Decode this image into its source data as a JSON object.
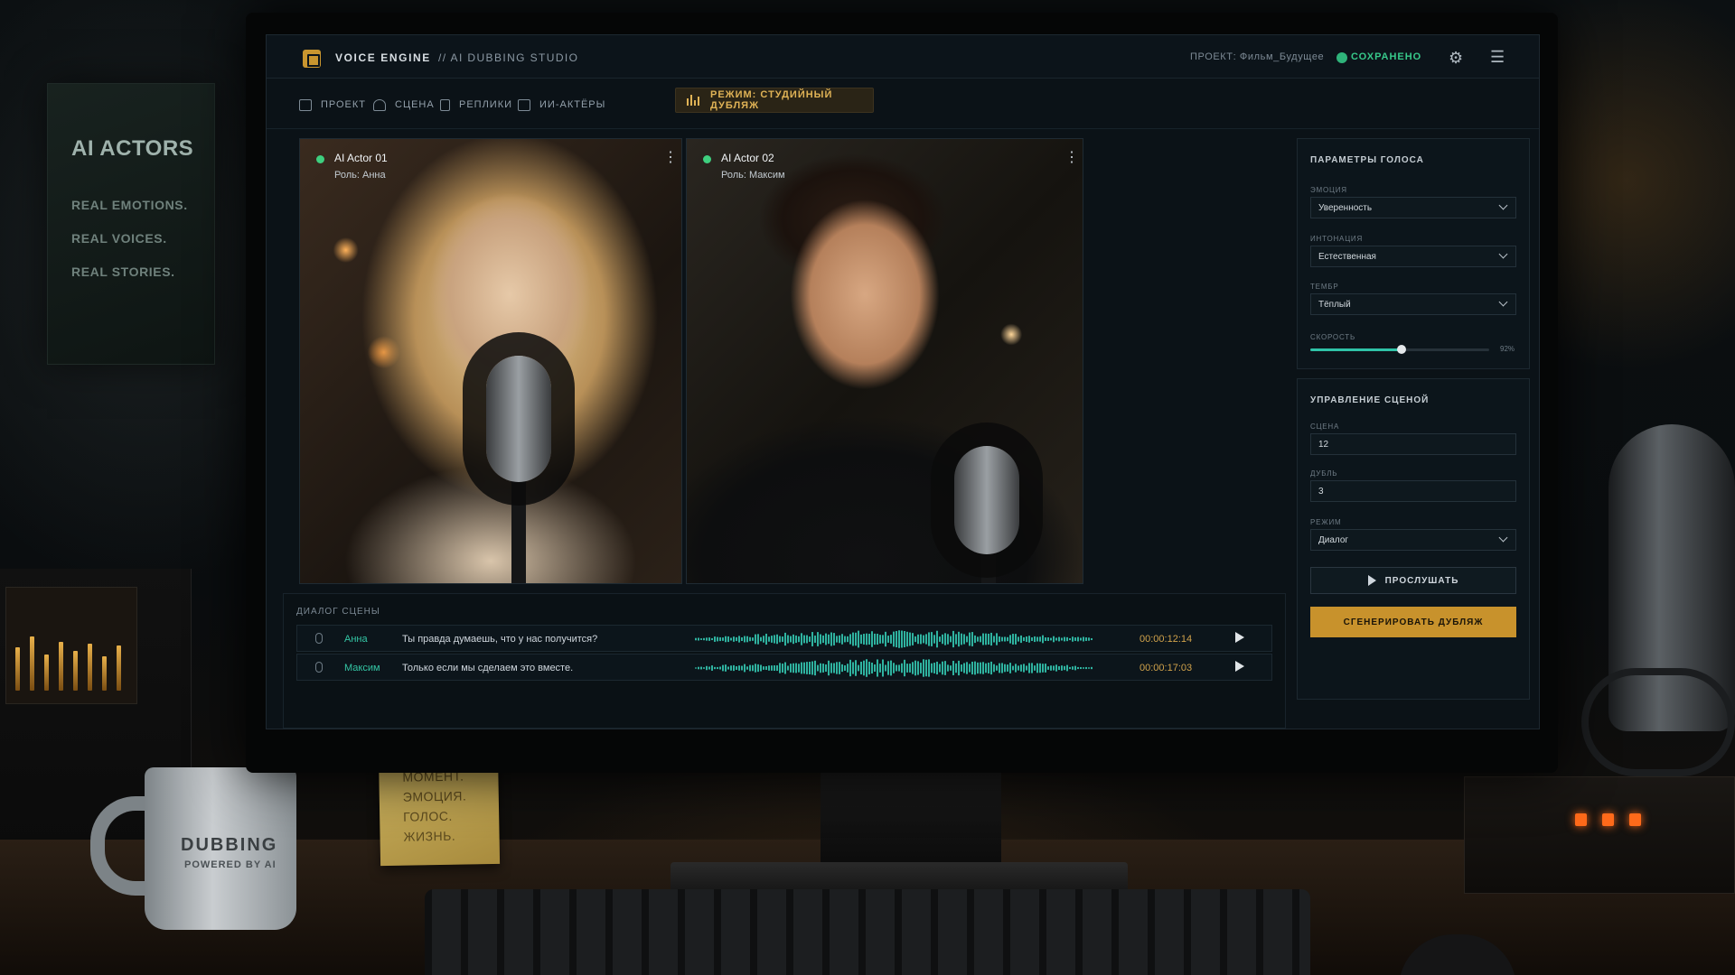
{
  "environment": {
    "poster": {
      "title": "AI ACTORS",
      "lines": [
        "REAL EMOTIONS.",
        "REAL VOICES.",
        "REAL STORIES."
      ]
    },
    "mug": {
      "title": "DUBBING",
      "subtitle": "POWERED BY AI"
    },
    "sticky_note": {
      "lines": [
        "МОМЕНТ.",
        "ЭМОЦИЯ.",
        "ГОЛОС.",
        "ЖИЗНЬ."
      ]
    }
  },
  "app": {
    "title": "VOICE ENGINE",
    "subtitle": "// AI DUBBING STUDIO",
    "project": "ПРОЕКТ: Фильм_Будущее",
    "save_status": "СОХРАНЕНО",
    "accent_color": "#c8922c",
    "status_color": "#37c98a"
  },
  "tabs": [
    {
      "label": "ПРОЕКТ",
      "icon": "project-icon"
    },
    {
      "label": "СЦЕНА",
      "icon": "scene-icon"
    },
    {
      "label": "РЕПЛИКИ",
      "icon": "lines-icon"
    },
    {
      "label": "ИИ-АКТЁРЫ",
      "icon": "actors-icon"
    }
  ],
  "mode_tab": {
    "label": "РЕЖИМ: СТУДИЙНЫЙ ДУБЛЯЖ",
    "icon": "equalizer-icon"
  },
  "actors": [
    {
      "name": "AI Actor 01",
      "role": "Роль: Анна",
      "status": "online"
    },
    {
      "name": "AI Actor 02",
      "role": "Роль: Максим",
      "status": "online"
    }
  ],
  "dialogue": {
    "title": "ДИАЛОГ СЦЕНЫ",
    "rows": [
      {
        "speaker": "Анна",
        "text": "Ты правда думаешь, что у нас получится?",
        "time": "00:00:12:14"
      },
      {
        "speaker": "Максим",
        "text": "Только если мы сделаем это вместе.",
        "time": "00:00:17:03"
      }
    ]
  },
  "voice_params": {
    "title": "ПАРАМЕТРЫ ГОЛОСА",
    "emotion_label": "ЭМОЦИЯ",
    "emotion_value": "Уверенность",
    "intonation_label": "ИНТОНАЦИЯ",
    "intonation_value": "Естественная",
    "timbre_label": "ТЕМБР",
    "timbre_value": "Тёплый",
    "speed_label": "СКОРОСТЬ",
    "speed_value": "92%",
    "speed_fraction": 0.51
  },
  "scene_control": {
    "title": "УПРАВЛЕНИЕ СЦЕНОЙ",
    "scene_label": "СЦЕНА",
    "scene_value": "12",
    "take_label": "ДУБЛЬ",
    "take_value": "3",
    "mode_label": "РЕЖИМ",
    "mode_value": "Диалог",
    "listen_button": "ПРОСЛУШАТЬ",
    "generate_button": "СГЕНЕРИРОВАТЬ ДУБЛЯЖ"
  }
}
